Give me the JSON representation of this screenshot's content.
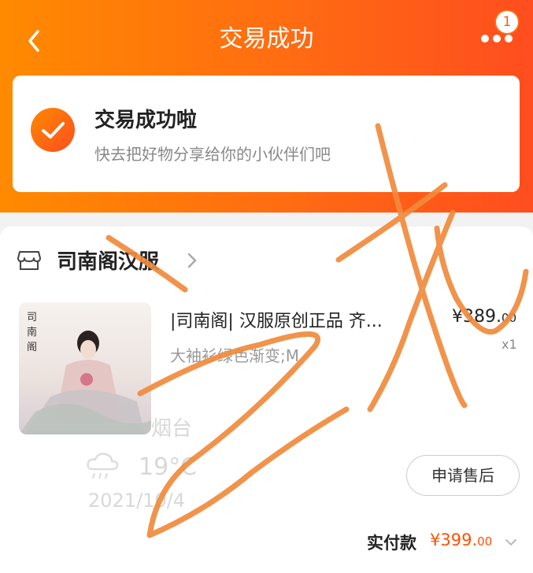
{
  "header": {
    "title": "交易成功",
    "back_icon": "chevron-left-icon",
    "more_icon": "more-dots-icon",
    "badge_count": "1",
    "gradient": [
      "#ff8a00",
      "#ff4d1f"
    ]
  },
  "status": {
    "icon": "check-circle-icon",
    "title": "交易成功啦",
    "subtitle": "快去把好物分享给你的小伙伴们吧"
  },
  "shop": {
    "icon": "store-icon",
    "name": "司南阁汉服"
  },
  "product": {
    "name": "|司南阁| 汉服原创正品 齐...",
    "price_symbol": "¥",
    "price_int": "389.",
    "price_dec": "00",
    "quantity": "x1",
    "sku": "大袖衫绿色渐变;M",
    "thumb_text": "司南阁"
  },
  "watermark": {
    "city": "烟台",
    "temperature": "19°C",
    "date": "2021/10/4",
    "weather_icon": "rain-cloud-icon"
  },
  "actions": {
    "after_sale": "申请售后"
  },
  "payment": {
    "label": "实付款",
    "currency": "¥",
    "amount_int": "399.",
    "amount_dec": "00"
  },
  "colors": {
    "accent": "#ff5000",
    "scribble": "#f08a3c"
  }
}
